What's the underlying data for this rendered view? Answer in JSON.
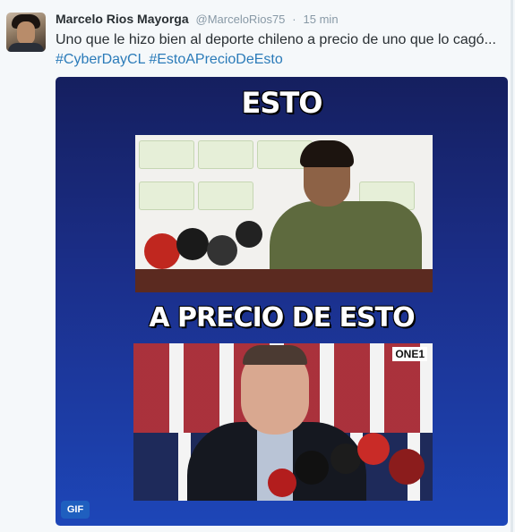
{
  "tweet": {
    "fullname": "Marcelo Rios Mayorga",
    "username": "@MarceloRios75",
    "separator": "·",
    "time": "15 min",
    "text": "Uno que le hizo bien al deporte chileno a precio de uno que lo cagó...",
    "hashtags": [
      "#CyberDayCL",
      "#EstoAPrecioDeEsto"
    ]
  },
  "media": {
    "caption_top": "ESTO",
    "caption_bottom": "A PRECIO DE ESTO",
    "photo2_logo": "ONE1",
    "gif_badge": "GIF"
  },
  "colors": {
    "link": "#2b7bb9",
    "name": "#292f33",
    "meta": "#8899a6",
    "background": "#f5f8fa"
  }
}
